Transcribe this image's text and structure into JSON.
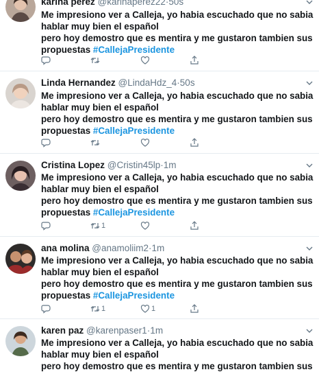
{
  "tweets": [
    {
      "name": "karina perez",
      "handle": "@karinaperez22",
      "separator": "·",
      "time": "50s",
      "lines": [
        "Me impresiono ver a Calleja, yo habia escuchado que no sabia",
        "hablar muy bien el español",
        "pero hoy demostro que es mentira y me gustaron tambien sus",
        "propuestas"
      ],
      "hashtag": "#CallejaPresidente",
      "retweets": "",
      "likes": ""
    },
    {
      "name": "Linda Hernandez",
      "handle": "@LindaHdz_4",
      "separator": "·",
      "time": "50s",
      "lines": [
        "Me impresiono ver a Calleja, yo habia escuchado que no sabia",
        "hablar muy bien el español",
        "pero hoy demostro que es mentira y me gustaron tambien sus",
        "propuestas"
      ],
      "hashtag": "#CallejaPresidente",
      "retweets": "",
      "likes": ""
    },
    {
      "name": "Cristina Lopez",
      "handle": "@Cristin45lp",
      "separator": "·",
      "time": "1m",
      "lines": [
        "Me impresiono ver a Calleja, yo habia escuchado que no sabia",
        "hablar muy bien el español",
        "pero hoy demostro que es mentira y me gustaron tambien sus",
        "propuestas"
      ],
      "hashtag": "#CallejaPresidente",
      "retweets": "1",
      "likes": ""
    },
    {
      "name": "ana molina",
      "handle": "@anamoliim2",
      "separator": "·",
      "time": "1m",
      "lines": [
        "Me impresiono ver a Calleja, yo habia escuchado que no sabia",
        "hablar muy bien el español",
        "pero hoy demostro que es mentira y me gustaron tambien sus",
        "propuestas"
      ],
      "hashtag": "#CallejaPresidente",
      "retweets": "1",
      "likes": "1"
    },
    {
      "name": "karen paz",
      "handle": "@karenpaser1",
      "separator": "·",
      "time": "1m",
      "lines": [
        "Me impresiono ver a Calleja, yo habia escuchado que no sabia",
        "hablar muy bien el español",
        "pero hoy demostro que es mentira y me gustaron tambien sus"
      ],
      "hashtag": "",
      "retweets": "",
      "likes": ""
    }
  ],
  "icons": {
    "reply": "reply-icon",
    "retweet": "retweet-icon",
    "like": "like-icon",
    "share": "share-icon",
    "caret": "chevron-down-icon"
  },
  "colors": {
    "text": "#14171a",
    "muted": "#657786",
    "hashtag": "#1b95e0",
    "divider": "#e6ecf0"
  }
}
